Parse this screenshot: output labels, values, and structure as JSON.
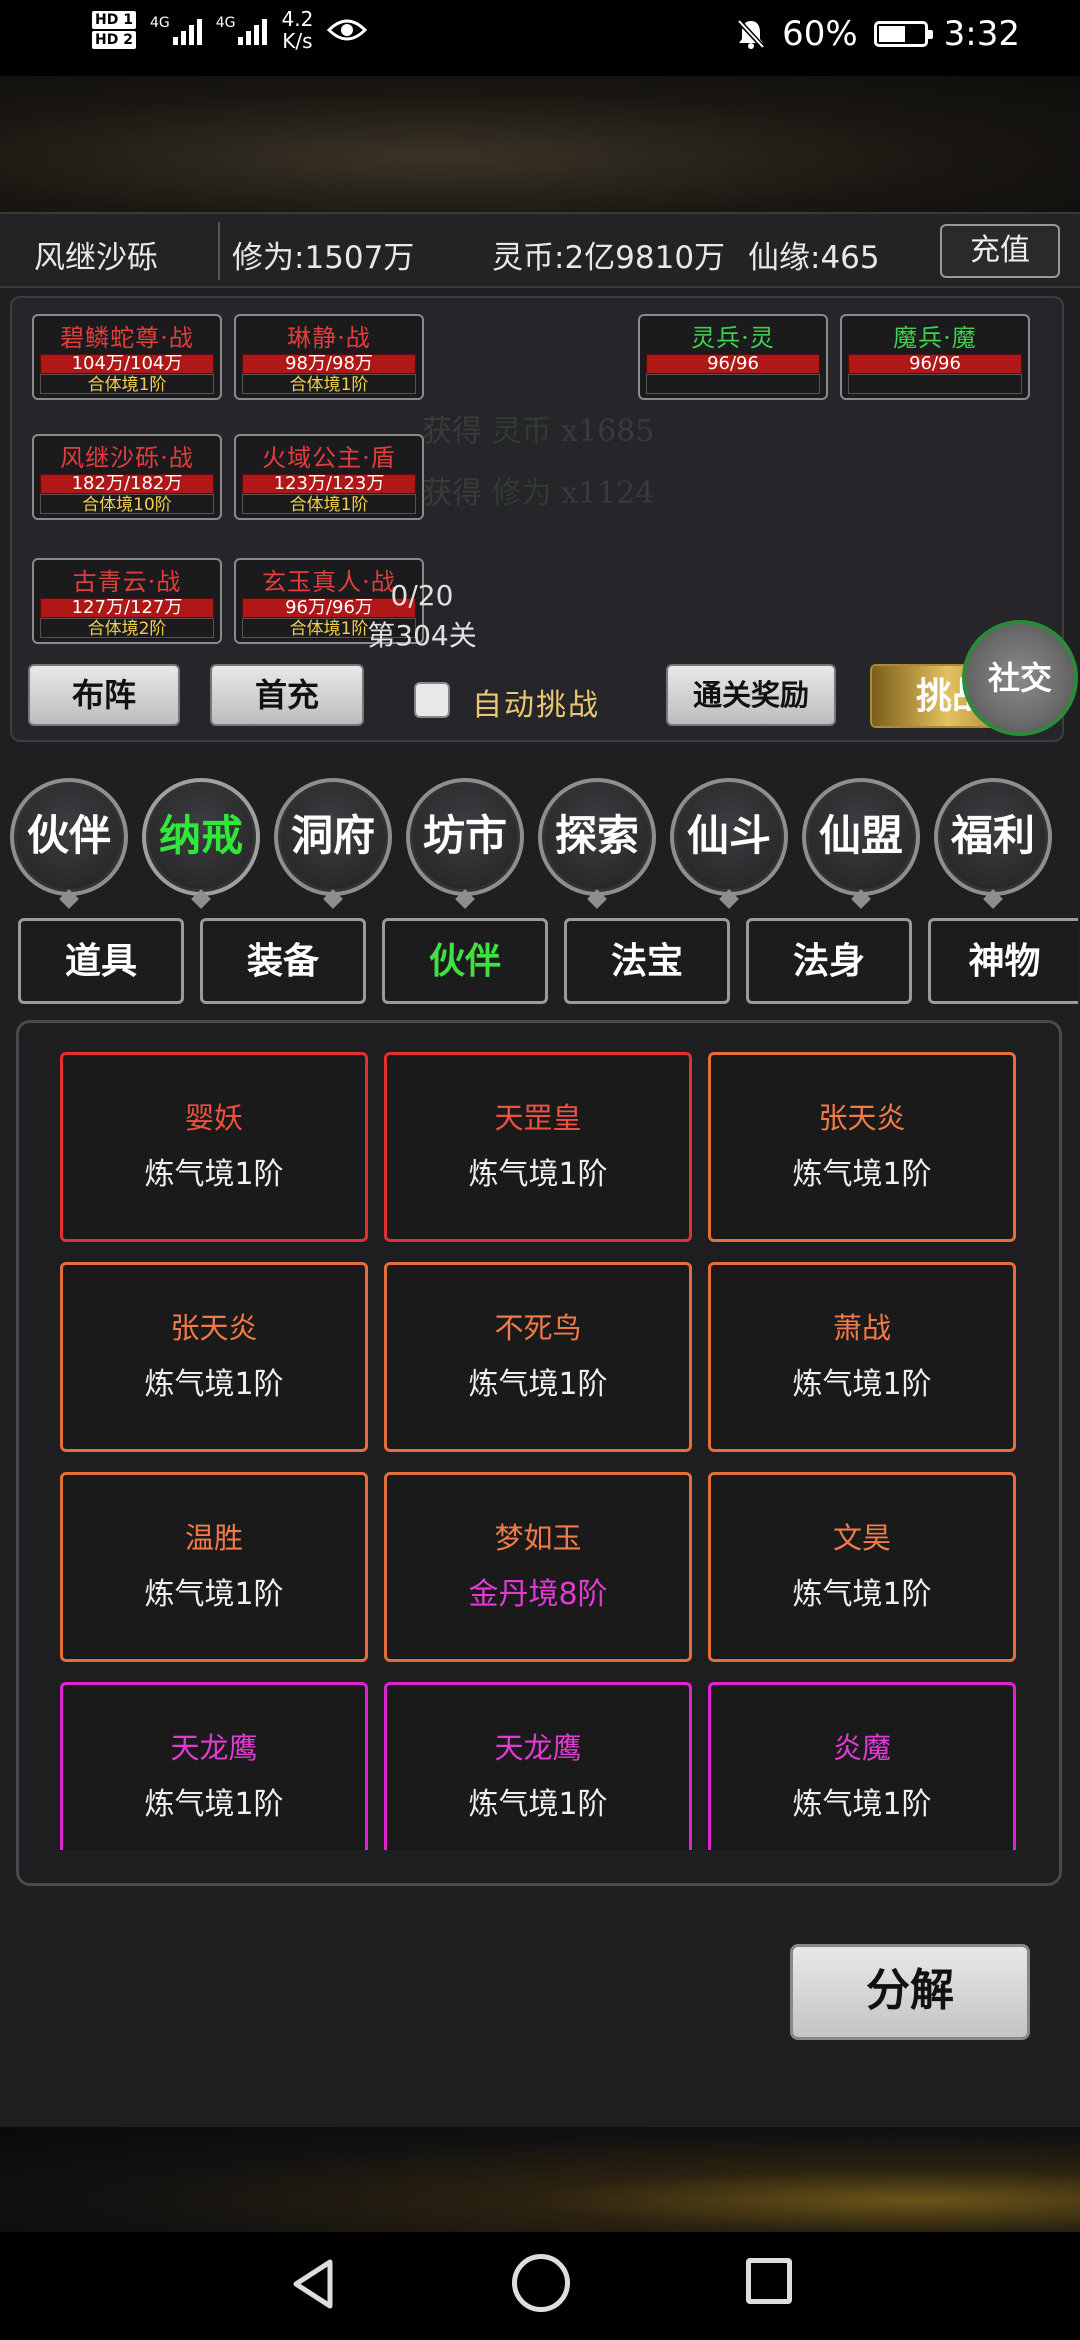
{
  "status_bar": {
    "hd1": "HD 1",
    "hd2": "HD 2",
    "net1": "4G",
    "net2": "4G",
    "speed": "4.2",
    "speed_unit": "K/s",
    "battery": "60%",
    "battery_level": 0.6,
    "time": "3:32",
    "icons": [
      "eye-icon",
      "bell-muted-icon",
      "battery-icon"
    ]
  },
  "player": {
    "name": "风继沙砾",
    "cultivation": "修为:1507万",
    "spirit_coins": "灵币:2亿9810万",
    "fate": "仙缘:465",
    "recharge": "充值"
  },
  "battle": {
    "team": [
      {
        "name": "碧鳞蛇尊·战",
        "hp": "104万/104万",
        "realm": "合体境1阶"
      },
      {
        "name": "琳静·战",
        "hp": "98万/98万",
        "realm": "合体境1阶"
      },
      {
        "name": "风继沙砾·战",
        "hp": "182万/182万",
        "realm": "合体境10阶"
      },
      {
        "name": "火域公主·盾",
        "hp": "123万/123万",
        "realm": "合体境1阶"
      },
      {
        "name": "古青云·战",
        "hp": "127万/127万",
        "realm": "合体境2阶"
      },
      {
        "name": "玄玉真人·战",
        "hp": "96万/96万",
        "realm": "合体境1阶"
      }
    ],
    "enemies": [
      {
        "name": "灵兵·灵",
        "hp": "96/96"
      },
      {
        "name": "魔兵·魔",
        "hp": "96/96"
      }
    ],
    "log": [
      {
        "prefix": "获得",
        "item": "灵币",
        "amount": "x1685"
      },
      {
        "prefix": "获得",
        "item": "修为",
        "amount": "x1124"
      }
    ],
    "wave": "0/20",
    "stage": "第304关",
    "buttons": {
      "formation": "布阵",
      "first_recharge": "首充",
      "auto_challenge": "自动挑战",
      "clear_reward": "通关奖励",
      "challenge": "挑战",
      "social": "社交"
    }
  },
  "main_nav": [
    {
      "label": "伙伴",
      "active": false
    },
    {
      "label": "纳戒",
      "active": true
    },
    {
      "label": "洞府",
      "active": false
    },
    {
      "label": "坊市",
      "active": false
    },
    {
      "label": "探索",
      "active": false
    },
    {
      "label": "仙斗",
      "active": false
    },
    {
      "label": "仙盟",
      "active": false
    },
    {
      "label": "福利",
      "active": false
    }
  ],
  "sub_tabs": [
    {
      "label": "道具",
      "active": false
    },
    {
      "label": "装备",
      "active": false
    },
    {
      "label": "伙伴",
      "active": true
    },
    {
      "label": "法宝",
      "active": false
    },
    {
      "label": "法身",
      "active": false
    },
    {
      "label": "神物",
      "active": false
    }
  ],
  "companions": [
    {
      "name": "婴妖",
      "realm": "炼气境1阶",
      "rarity": "red"
    },
    {
      "name": "天罡皇",
      "realm": "炼气境1阶",
      "rarity": "red"
    },
    {
      "name": "张天炎",
      "realm": "炼气境1阶",
      "rarity": "orange"
    },
    {
      "name": "张天炎",
      "realm": "炼气境1阶",
      "rarity": "orange"
    },
    {
      "name": "不死鸟",
      "realm": "炼气境1阶",
      "rarity": "orange"
    },
    {
      "name": "萧战",
      "realm": "炼气境1阶",
      "rarity": "orange"
    },
    {
      "name": "温胜",
      "realm": "炼气境1阶",
      "rarity": "orange"
    },
    {
      "name": "梦如玉",
      "realm": "金丹境8阶",
      "rarity": "orange"
    },
    {
      "name": "文昊",
      "realm": "炼气境1阶",
      "rarity": "orange"
    },
    {
      "name": "天龙鹰",
      "realm": "炼气境1阶",
      "rarity": "purple"
    },
    {
      "name": "天龙鹰",
      "realm": "炼气境1阶",
      "rarity": "purple"
    },
    {
      "name": "炎魔",
      "realm": "炼气境1阶",
      "rarity": "purple"
    }
  ],
  "decompose": "分解",
  "colors": {
    "red": "#e23030",
    "orange": "#e46d3a",
    "purple": "#e023d2",
    "active_green": "#2fe83a",
    "gold": "#e8c870"
  }
}
